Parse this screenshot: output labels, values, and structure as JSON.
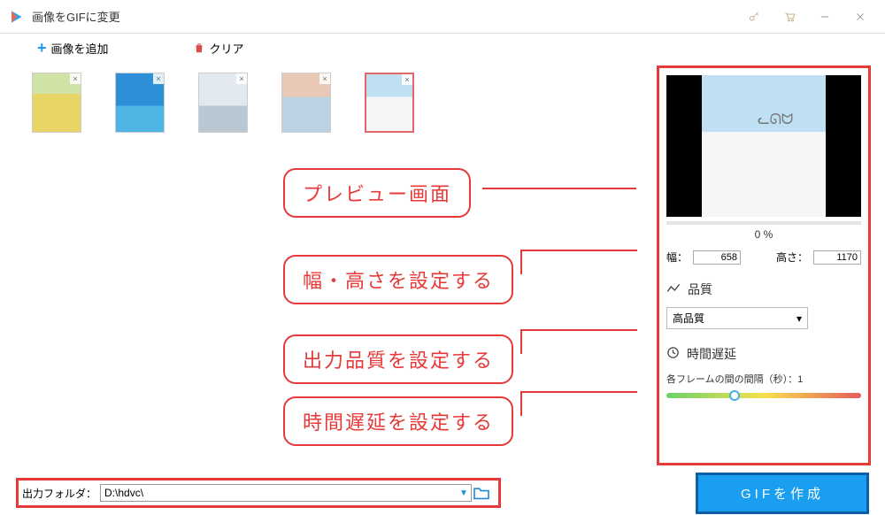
{
  "window": {
    "title": "画像をGIFに変更"
  },
  "toolbar": {
    "add_label": "画像を追加",
    "clear_label": "クリア"
  },
  "thumbnails": [
    {
      "remove": "×",
      "selected": false
    },
    {
      "remove": "×",
      "selected": false
    },
    {
      "remove": "×",
      "selected": false
    },
    {
      "remove": "×",
      "selected": false
    },
    {
      "remove": "×",
      "selected": true
    }
  ],
  "annotations": {
    "preview": "プレビュー画面",
    "dimensions": "幅・高さを設定する",
    "quality": "出力品質を設定する",
    "delay": "時間遅延を設定する"
  },
  "preview": {
    "progress_text": "0 %",
    "progress_value": 0
  },
  "dimensions": {
    "width_label": "幅：",
    "width_value": "658",
    "height_label": "高さ：",
    "height_value": "1170"
  },
  "quality": {
    "section_title": "品質",
    "selected": "高品質"
  },
  "delay": {
    "section_title": "時間遅延",
    "label_prefix": "各フレームの間の間隔（秒）：",
    "value": "1",
    "slider_position_pct": 35
  },
  "output": {
    "label": "出力フォルダ：",
    "path": "D:\\hdvc\\"
  },
  "create_button": "GIFを作成"
}
